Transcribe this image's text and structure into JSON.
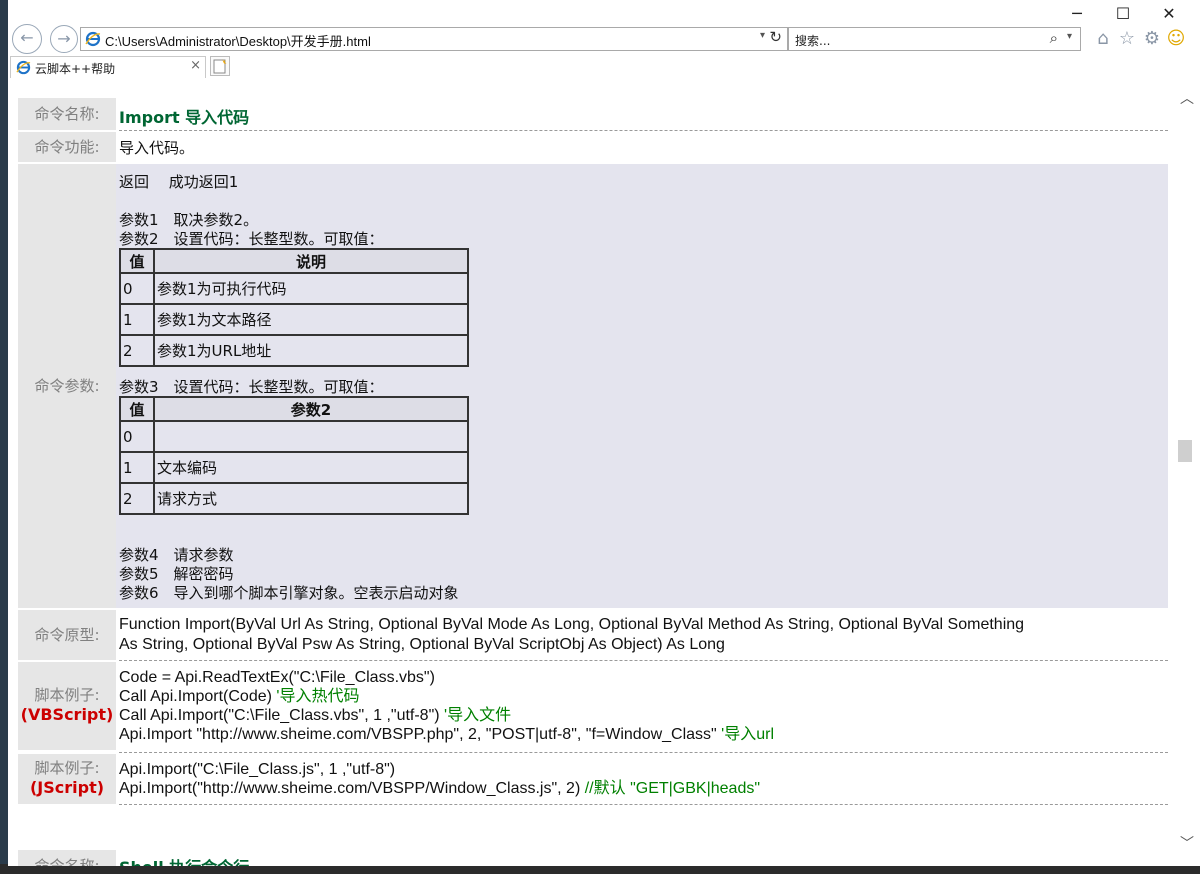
{
  "window": {
    "caption_buttons": {
      "minimize": "─",
      "maximize": "☐",
      "close": "✕"
    }
  },
  "nav": {
    "back_icon": "←",
    "forward_icon": "→",
    "address": "C:\\Users\\Administrator\\Desktop\\开发手册.html",
    "address_dropdown": "▾",
    "refresh_icon": "↻",
    "search_placeholder": "搜索...",
    "search_icon": "⌕",
    "search_dropdown": "▾",
    "toolbar_icons": {
      "home": "⌂",
      "favorites": "☆",
      "settings": "⚙",
      "feedback": "☺"
    }
  },
  "tab": {
    "title": "云脚本++帮助",
    "close": "×"
  },
  "command": {
    "name_label": "命令名称:",
    "name_value": "Import 导入代码",
    "function_label": "命令功能:",
    "function_value": "导入代码。",
    "params_label": "命令参数:",
    "return_line": "返回　 成功返回1",
    "param1": "参数1　取决参数2。",
    "param2": "参数2　设置代码：长整型数。可取值：",
    "table1": {
      "headers": [
        "值",
        "说明"
      ],
      "rows": [
        [
          "0",
          "参数1为可执行代码"
        ],
        [
          "1",
          "参数1为文本路径"
        ],
        [
          "2",
          "参数1为URL地址"
        ]
      ]
    },
    "param3": "参数3　设置代码：长整型数。可取值：",
    "table2": {
      "headers": [
        "值",
        "参数2"
      ],
      "rows": [
        [
          "0",
          ""
        ],
        [
          "1",
          "文本编码"
        ],
        [
          "2",
          "请求方式"
        ]
      ]
    },
    "param4": "参数4　请求参数",
    "param5": "参数5　解密密码",
    "param6": "参数6　导入到哪个脚本引擎对象。空表示启动对象",
    "proto_label": "命令原型:",
    "proto_line1": "Function Import(ByVal Url As String, Optional ByVal Mode As Long, Optional ByVal Method As String, Optional ByVal Something",
    "proto_line2": "As String, Optional ByVal Psw As String, Optional ByVal ScriptObj As Object) As Long",
    "vbs_label": "脚本例子:",
    "vbs_lang": "(VBScript)",
    "vbs_lines": [
      {
        "code": "Code = Api.ReadTextEx(\"C:\\File_Class.vbs\")",
        "comment": ""
      },
      {
        "code": "Call Api.Import(Code) ",
        "comment": "'导入热代码"
      },
      {
        "code": "Call Api.Import(\"C:\\File_Class.vbs\", 1 ,\"utf-8\") ",
        "comment": "'导入文件"
      },
      {
        "code": "Api.Import \"http://www.sheime.com/VBSPP.php\", 2, \"POST|utf-8\",  \"f=Window_Class\" ",
        "comment": "'导入url"
      }
    ],
    "js_label": "脚本例子:",
    "js_lang": "(JScript)",
    "js_lines": [
      {
        "code": "Api.Import(\"C:\\File_Class.js\", 1 ,\"utf-8\")",
        "comment": ""
      },
      {
        "code": "Api.Import(\"http://www.sheime.com/VBSPP/Window_Class.js\", 2) ",
        "comment": "//默认 \"GET|GBK|heads\""
      }
    ]
  },
  "next_command": {
    "name_label": "命令名称:",
    "name_value": "Shell 执行命令行"
  },
  "scrollbar": {
    "up": "︿",
    "down": "﹀"
  }
}
